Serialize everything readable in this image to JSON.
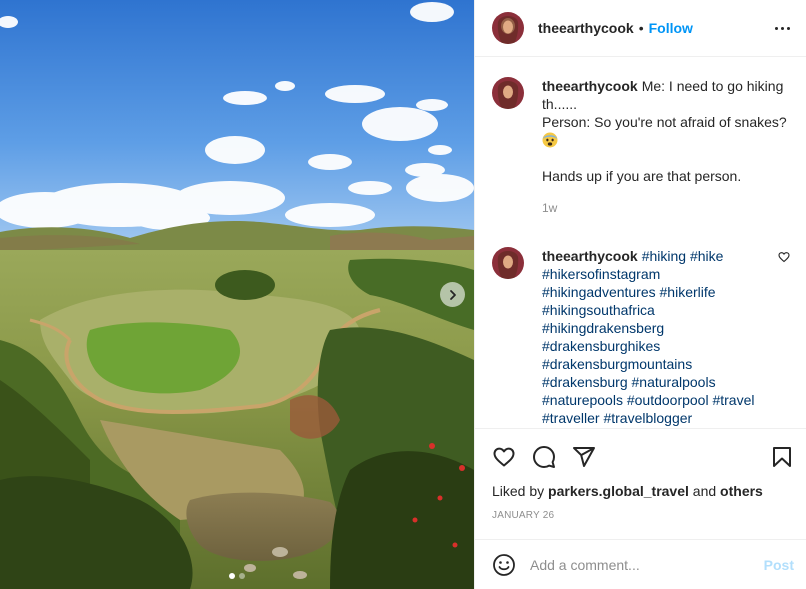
{
  "post": {
    "username": "theearthycook",
    "follow_label": "Follow",
    "separator": "•",
    "more_icon": "more-horizontal-icon"
  },
  "caption": {
    "username": "theearthycook",
    "lines": [
      "Me: I need to go hiking th......",
      "Person: So you're not afraid of snakes?",
      "Hands up if you are that person."
    ],
    "emoji_icon": "fearful-face-emoji",
    "time": "1w"
  },
  "comment": {
    "username": "theearthycook",
    "text": "#hiking #hike #hikersofinstagram #hikingadventures #hikerlife #hikingsouthafrica #hikingdrakensberg #drakensburghikes #drakensburgmountains #drakensburg #naturalpools #naturepools #outdoorpool #travel #traveller #travelblogger #travelphotography #travellife"
  },
  "actions": {
    "icons": [
      "heart-icon",
      "comment-icon",
      "share-icon",
      "bookmark-icon"
    ],
    "liked_prefix": "Liked by",
    "liked_user": "parkers.global_travel",
    "liked_and": "and",
    "liked_others": "others",
    "date": "JANUARY 26"
  },
  "add_comment": {
    "placeholder": "Add a comment...",
    "post_label": "Post"
  },
  "carousel": {
    "next_icon": "chevron-right-icon",
    "slide_count": 2,
    "active_index": 0
  },
  "colors": {
    "link_blue": "#0095f6",
    "hashtag": "#00376b",
    "muted": "#8e8e8e",
    "post_disabled": "#b2dffc"
  }
}
